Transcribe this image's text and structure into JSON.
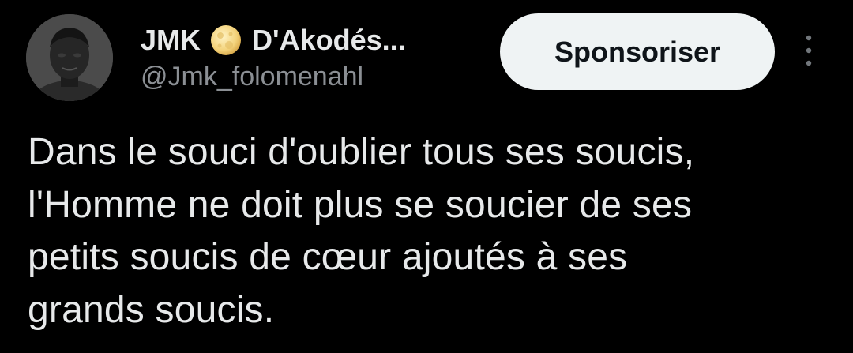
{
  "post": {
    "author": {
      "name_first": "JMK",
      "name_second": "D'Akodés...",
      "handle": "@Jmk_folomenahl",
      "badge_icon": "full-moon-emoji",
      "avatar_icon": "user-avatar-photo"
    },
    "sponsor_button_label": "Sponsoriser",
    "more_icon": "vertical-ellipsis-icon",
    "text_lines": [
      "Dans le souci d'oublier tous ses soucis,",
      "l'Homme ne doit plus se soucier de ses",
      "petits soucis de cœur ajoutés à ses",
      "grands soucis."
    ]
  },
  "colors": {
    "background": "#000000",
    "primary_text": "#e7e9ea",
    "secondary_text": "#8b8f94",
    "button_bg": "#eff3f4",
    "button_text": "#0f1419"
  }
}
